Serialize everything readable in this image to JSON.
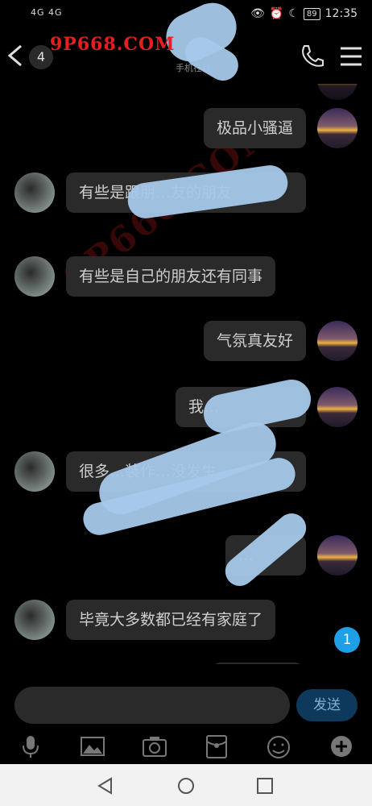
{
  "status_bar": {
    "network_left": "4G  4G",
    "battery": "89",
    "time": "12:35"
  },
  "header": {
    "unread_count": "4",
    "subtitle": "手机在线"
  },
  "watermark": {
    "text": "9P668.COM"
  },
  "messages": [
    {
      "side": "right",
      "text": "极品小骚逼"
    },
    {
      "side": "left",
      "text": "有些是跟朋…友的朋友"
    },
    {
      "side": "left",
      "text": "有些是自己的朋友还有同事"
    },
    {
      "side": "right",
      "text": "气氛真友好"
    },
    {
      "side": "right",
      "text": "我…"
    },
    {
      "side": "left",
      "text": "很多…装作…没发生…"
    },
    {
      "side": "right",
      "text": "…"
    },
    {
      "side": "left",
      "text": "毕竟大多数都已经有家庭了"
    }
  ],
  "new_message_badge": "1",
  "composer": {
    "send_label": "发送"
  },
  "toolbar": {
    "icons": [
      "mic-icon",
      "image-icon",
      "camera-icon",
      "red-packet-icon",
      "emoji-icon",
      "plus-icon"
    ]
  },
  "nav_bar": {
    "icons": [
      "back-triangle-icon",
      "home-circle-icon",
      "recents-square-icon"
    ]
  }
}
